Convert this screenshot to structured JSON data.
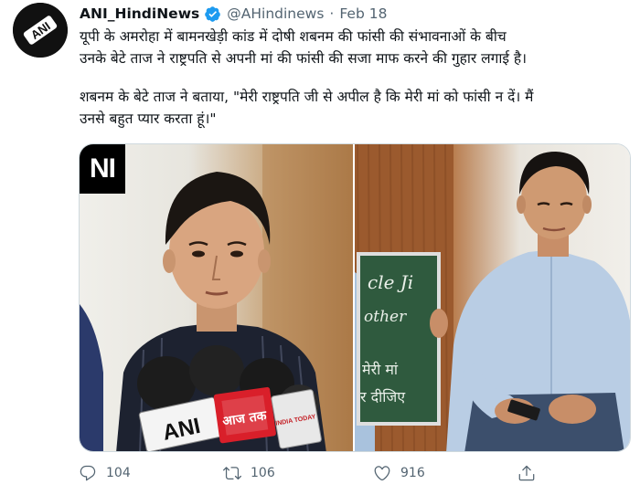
{
  "tweet": {
    "display_name": "ANI_HindiNews",
    "handle": "@AHindinews",
    "separator": "·",
    "date": "Feb 18",
    "avatar_icon": "ani-logo",
    "text_line1": "यूपी के अमरोहा में बामनखेड़ी कांड में दोषी शबनम की फांसी की संभावनाओं के बीच",
    "text_line2": "उनके बेटे ताज ने राष्ट्रपति से अपनी मां की फांसी की सजा माफ करने की गुहार लगाई है।",
    "text_line3": "शबनम के बेटे ताज ने बताया, \"मेरी राष्ट्रपति जी से अपील है कि मेरी मां को फांसी न दें। मैं",
    "text_line4": "उनसे बहुत प्यार करता हूं।\""
  },
  "media": {
    "left_photo_watermark": "NI",
    "mic_label_ani": "ANI",
    "mic_label_aajtak": "आज तक",
    "mic_label_india": "INDIA TODAY",
    "board_lines": [
      "cle Ji",
      "other",
      "मेरी मां",
      "र दीजिए"
    ]
  },
  "actions": {
    "reply_count": "104",
    "retweet_count": "106",
    "like_count": "916",
    "reply_icon": "reply-icon",
    "retweet_icon": "retweet-icon",
    "like_icon": "heart-icon",
    "share_icon": "share-icon"
  },
  "colors": {
    "verified": "#1d9bf0",
    "secondary_text": "#536471",
    "primary_text": "#0f1419"
  }
}
